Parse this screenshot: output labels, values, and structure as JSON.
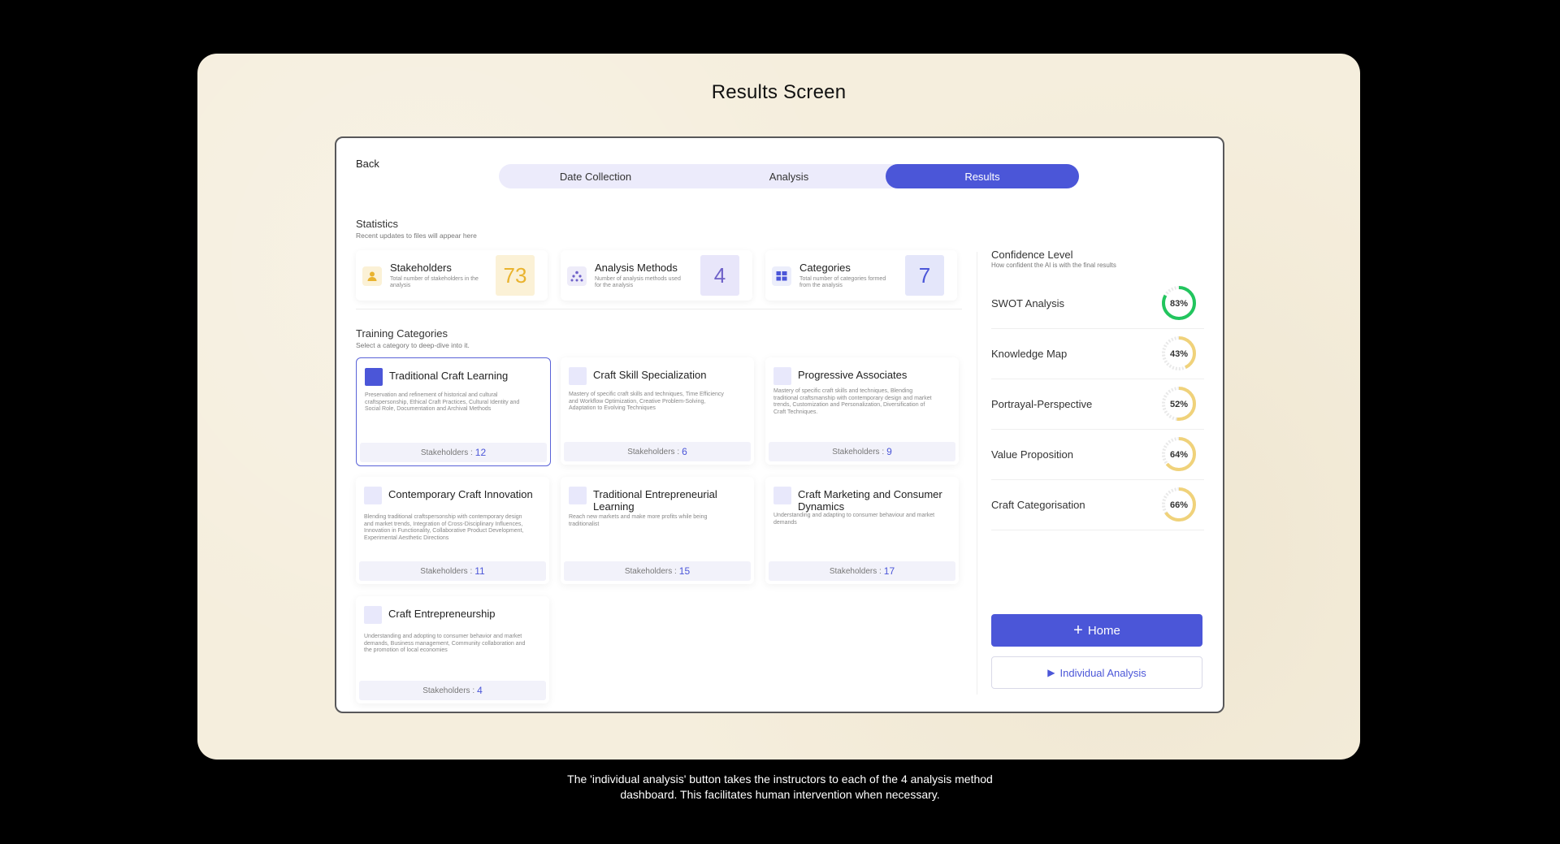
{
  "page_title": "Results Screen",
  "caption": {
    "line1": "The 'individual analysis' button takes the instructors to each of the 4 analysis method",
    "line2": "dashboard. This facilitates human intervention when necessary."
  },
  "nav": {
    "back": "Back",
    "tabs": [
      "Date Collection",
      "Analysis",
      "Results"
    ],
    "active_tab": "Results"
  },
  "statistics": {
    "title": "Statistics",
    "subtitle": "Recent updates to files will appear here",
    "cards": [
      {
        "label": "Stakeholders",
        "desc": "Total number of stakeholders in the analysis",
        "value": "73",
        "icon": "person-icon",
        "color": "#e9b32e"
      },
      {
        "label": "Analysis Methods",
        "desc": "Number of analysis methods used for the analysis",
        "value": "4",
        "icon": "nodes-icon",
        "color": "#6e61c8"
      },
      {
        "label": "Categories",
        "desc": "Total number of categories formed from the analysis",
        "value": "7",
        "icon": "grid-icon",
        "color": "#4b56d8"
      }
    ]
  },
  "training": {
    "title": "Training Categories",
    "subtitle": "Select a category to deep-dive into it.",
    "stakeholders_label": "Stakeholders :",
    "categories": [
      {
        "title": "Traditional Craft Learning",
        "desc": "Preservation and refinement of historical and cultural craftspersonship, Ethical Craft Practices, Cultural Identity and Social Role, Documentation and Archival Methods",
        "count": "12",
        "selected": true
      },
      {
        "title": "Craft Skill Specialization",
        "desc": "Mastery of specific craft skills and techniques, Time Efficiency and Workflow Optimization, Creative Problem-Solving, Adaptation to Evolving Techniques",
        "count": "6",
        "selected": false
      },
      {
        "title": "Progressive Associates",
        "desc": "Mastery of specific craft skills and techniques, Blending traditional craftsmanship with contemporary design and market trends, Customization and Personalization, Diversification of Craft Techniques.",
        "count": "9",
        "selected": false
      },
      {
        "title": "Contemporary Craft Innovation",
        "desc": "Blending traditional craftspersonship with contemporary design and market trends, Integration of Cross-Disciplinary Influences, Innovation in Functionality, Collaborative Product Development, Experimental Aesthetic Directions",
        "count": "11",
        "selected": false
      },
      {
        "title": "Traditional Entrepreneurial Learning",
        "desc": "Reach new markets and make more profits while being traditionalist",
        "count": "15",
        "selected": false
      },
      {
        "title": "Craft Marketing and Consumer Dynamics",
        "desc": "Understanding and adapting to consumer behaviour and market demands",
        "count": "17",
        "selected": false
      },
      {
        "title": "Craft Entrepreneurship",
        "desc": "Understanding and adopting to consumer behavior and market demands, Business management, Community collaboration and the promotion of local economies",
        "count": "4",
        "selected": false
      }
    ]
  },
  "confidence": {
    "title": "Confidence Level",
    "subtitle": "How confident the AI is with the final results",
    "items": [
      {
        "label": "SWOT Analysis",
        "value": 83,
        "text": "83%",
        "color": "#22c55e"
      },
      {
        "label": "Knowledge Map",
        "value": 43,
        "text": "43%",
        "color": "#f0d27a"
      },
      {
        "label": "Portrayal-Perspective",
        "value": 52,
        "text": "52%",
        "color": "#f0d27a"
      },
      {
        "label": "Value Proposition",
        "value": 64,
        "text": "64%",
        "color": "#f0d27a"
      },
      {
        "label": "Craft Categorisation",
        "value": 66,
        "text": "66%",
        "color": "#f0d27a"
      }
    ]
  },
  "actions": {
    "home": "Home",
    "individual": "Individual Analysis"
  },
  "colors": {
    "accent": "#4b56d8",
    "tab_bg": "#ecebfb",
    "paper": "#f5eedd"
  }
}
